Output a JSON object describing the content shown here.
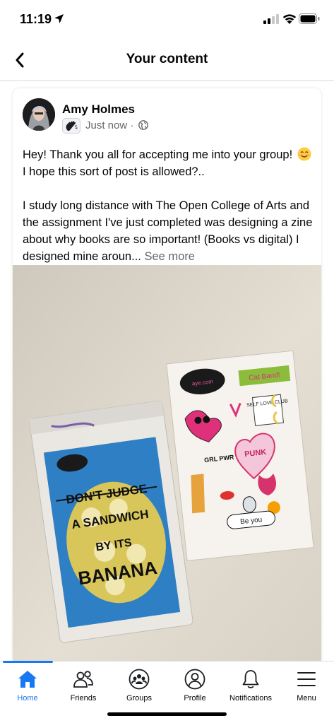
{
  "status_bar": {
    "time": "11:19",
    "location_icon": "location-arrow-icon",
    "signal_icon": "cellular-signal-icon",
    "wifi_icon": "wifi-icon",
    "battery_icon": "battery-icon"
  },
  "header": {
    "back_icon": "chevron-left-icon",
    "title": "Your content"
  },
  "post": {
    "author": "Amy Holmes",
    "badge_icon": "waving-hand-icon",
    "timestamp": "Just now · ",
    "privacy_icon": "globe-icon",
    "paragraph_1_a": "Hey! Thank you all for accepting me into your group! ",
    "paragraph_1_emoji": "smiling-face-icon",
    "paragraph_1_b": " I hope this sort of post is allowed?..",
    "paragraph_2": "I study long distance with The Open College of Arts and the assignment I've just completed was designing a zine about why books are so important! (Books vs digital) I designed mine aroun... ",
    "see_more": "See more",
    "photo": {
      "zine_title_lines": [
        "DON'T JUDGE",
        "A SANDWICH",
        "BY ITS",
        "BANANA"
      ],
      "stickers": [
        "Cat Band!",
        "SELF LOVE CLUB",
        "GRL PWR",
        "PUNK",
        "Be you"
      ]
    }
  },
  "tab_bar": {
    "tabs": [
      {
        "label": "Home",
        "icon": "home-icon",
        "active": true
      },
      {
        "label": "Friends",
        "icon": "friends-icon",
        "active": false
      },
      {
        "label": "Groups",
        "icon": "groups-icon",
        "active": false
      },
      {
        "label": "Profile",
        "icon": "profile-icon",
        "active": false
      },
      {
        "label": "Notifications",
        "icon": "bell-icon",
        "active": false
      },
      {
        "label": "Menu",
        "icon": "menu-icon",
        "active": false
      }
    ]
  },
  "colors": {
    "accent": "#1877f2",
    "text": "#050505",
    "secondary_text": "#65676b"
  }
}
